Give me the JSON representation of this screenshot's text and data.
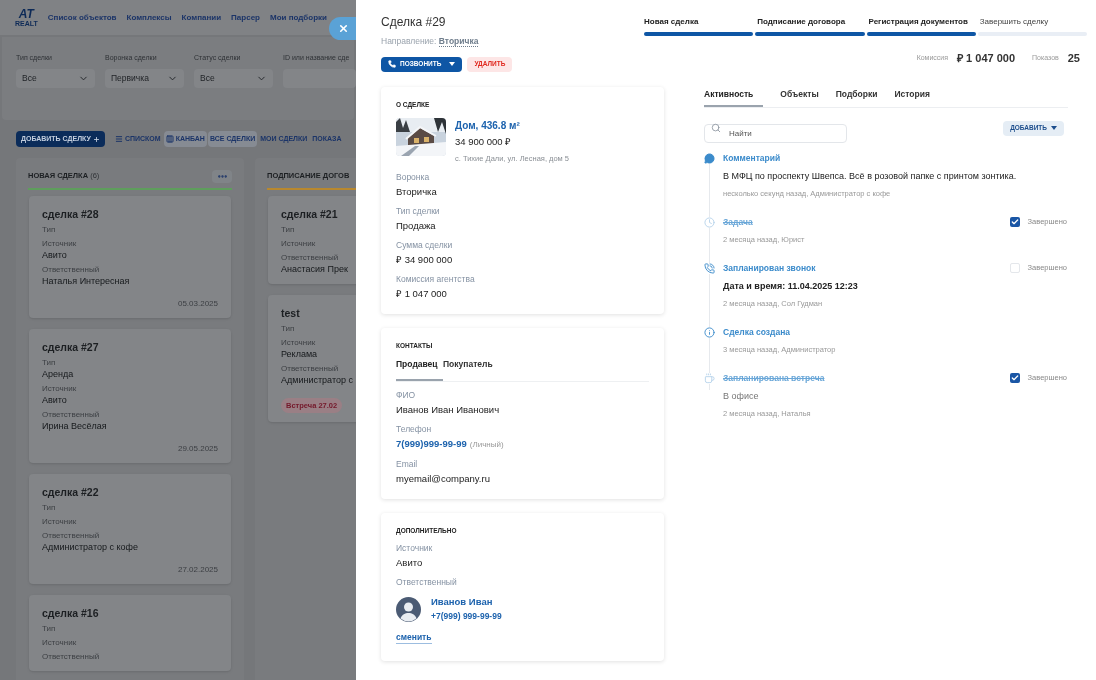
{
  "background": {
    "logo": {
      "mark": "AT",
      "sub": "REALT"
    },
    "nav": [
      "Список объектов",
      "Комплексы",
      "Компании",
      "Парсер",
      "Мои подборки"
    ],
    "filters": [
      {
        "label": "Тип сделки",
        "value": "Все",
        "kind": "select"
      },
      {
        "label": "Воронка сделки",
        "value": "Первичка",
        "kind": "select"
      },
      {
        "label": "Статус сделки",
        "value": "Все",
        "kind": "select"
      },
      {
        "label": "ID или название сде",
        "kind": "input"
      }
    ],
    "add_button": "ДОБАВИТЬ СДЕЛКУ",
    "view_toggles": [
      {
        "label": "СПИСКОМ",
        "kind": "list",
        "selected": false
      },
      {
        "label": "КАНБАН",
        "kind": "kanban",
        "selected": true
      }
    ],
    "scope_toggles": [
      {
        "label": "ВСЕ СДЕЛКИ",
        "selected": true
      },
      {
        "label": "МОИ СДЕЛКИ",
        "selected": false
      },
      {
        "label": "ПОКАЗА",
        "selected": false
      }
    ],
    "columns": [
      {
        "title": "НОВАЯ СДЕЛКА",
        "count": "(6)",
        "color": "#5e9e5c",
        "cards": [
          {
            "title": "сделка #28",
            "fields": [
              {
                "label": "Тип"
              },
              {
                "label": "Источник",
                "value": "Авито"
              },
              {
                "label": "Ответственный",
                "value": "Наталья Интересная"
              }
            ],
            "date": "05.03.2025"
          },
          {
            "title": "сделка #27",
            "fields": [
              {
                "label": "Тип",
                "value": "Аренда"
              },
              {
                "label": "Источник",
                "value": "Авито"
              },
              {
                "label": "Ответственный",
                "value": "Ирина Весёлая"
              }
            ],
            "date": "29.05.2025"
          },
          {
            "title": "сделка #22",
            "fields": [
              {
                "label": "Тип"
              },
              {
                "label": "Источник"
              },
              {
                "label": "Ответственный",
                "value": "Администратор с кофе"
              }
            ],
            "date": "27.02.2025"
          },
          {
            "title": "сделка #16",
            "fields": [
              {
                "label": "Тип"
              },
              {
                "label": "Источник"
              },
              {
                "label": "Ответственный"
              }
            ]
          }
        ]
      },
      {
        "title": "ПОДПИСАНИЕ ДОГОВ",
        "color": "#b8882e",
        "cards": [
          {
            "title": "сделка #21",
            "fields": [
              {
                "label": "Тип"
              },
              {
                "label": "Источник"
              },
              {
                "label": "Ответственный",
                "value": "Анастасия Прек"
              }
            ]
          },
          {
            "title": "test",
            "fields": [
              {
                "label": "Тип"
              },
              {
                "label": "Источник",
                "value": "Реклама"
              },
              {
                "label": "Ответственный",
                "value": "Администратор с"
              }
            ],
            "badge": "Встреча 27.02"
          }
        ]
      }
    ]
  },
  "drawer": {
    "title": "Сделка #29",
    "direction_label": "Направление:",
    "direction_value": "Вторичка",
    "call_button": "ПОЗВОНИТЬ",
    "delete_button": "УДАЛИТЬ",
    "steps": [
      {
        "label": "Новая сделка",
        "done": true
      },
      {
        "label": "Подписание договора",
        "done": true
      },
      {
        "label": "Регистрация документов",
        "done": true
      },
      {
        "label": "Завершить сделку",
        "done": false
      }
    ],
    "commission_label": "Комиссия",
    "commission": "₽ 1 047 000",
    "views_label": "Показов",
    "views": "25",
    "deal_card": {
      "heading": "О СДЕЛКЕ",
      "object": {
        "title": "Дом, 436.8 м²",
        "price": "34 900 000 ₽",
        "address": "с. Тихие Дали, ул. Лесная, дом 5"
      },
      "fields": [
        {
          "label": "Воронка",
          "value": "Вторичка"
        },
        {
          "label": "Тип сделки",
          "value": "Продажа"
        },
        {
          "label": "Сумма сделки",
          "value": "₽ 34 900 000"
        },
        {
          "label": "Комиссия агентства",
          "value": "₽ 1 047 000"
        }
      ]
    },
    "contacts_card": {
      "heading": "КОНТАКТЫ",
      "tabs": [
        {
          "label": "Продавец",
          "selected": true
        },
        {
          "label": "Покупатель",
          "selected": false
        }
      ],
      "fields": [
        {
          "label": "ФИО",
          "value": "Иванов Иван Иванович",
          "kind": "text"
        },
        {
          "label": "Телефон",
          "value": "7(999)999-99-99",
          "note": "(Личный)",
          "kind": "link"
        },
        {
          "label": "Email",
          "value": "myemail@company.ru",
          "kind": "text"
        }
      ]
    },
    "extra_card": {
      "heading": "ДОПОЛНИТЕЛЬНО",
      "fields": [
        {
          "label": "Источник",
          "value": "Авито"
        }
      ],
      "responsible_label": "Ответственный",
      "responsible": {
        "name": "Иванов Иван",
        "phone": "+7(999) 999-99-99"
      },
      "change_link": "сменить"
    },
    "activity": {
      "tabs": [
        {
          "label": "Активность",
          "selected": true
        },
        {
          "label": "Объекты",
          "selected": false
        },
        {
          "label": "Подборки",
          "selected": false
        },
        {
          "label": "История",
          "selected": false
        }
      ],
      "search_placeholder": "Найти",
      "add_button": "ДОБАВИТЬ",
      "items": [
        {
          "kind": "comment",
          "title": "Комментарий",
          "body": "В МФЦ по проспекту Швепса. Всё в розовой папке с принтом зонтика.",
          "meta": "несколько секунд назад, Администратор с кофе"
        },
        {
          "kind": "task",
          "title": "Задача",
          "meta": "2 месяца назад, Юрист",
          "completed": true,
          "completed_label": "Завершено"
        },
        {
          "kind": "call",
          "title": "Запланирован звонок",
          "body": "Дата и время: 11.04.2025 12:23",
          "meta": "2 месяца назад, Сол Гудман",
          "completed": false,
          "completed_label": "Завершено"
        },
        {
          "kind": "info",
          "title": "Сделка создана",
          "meta": "3 месяца назад, Администратор"
        },
        {
          "kind": "meeting",
          "title": "Запланирована встреча",
          "body": "В офисе",
          "meta": "2 месяца назад, Наталья",
          "completed": true,
          "completed_label": "Завершено"
        }
      ]
    }
  }
}
